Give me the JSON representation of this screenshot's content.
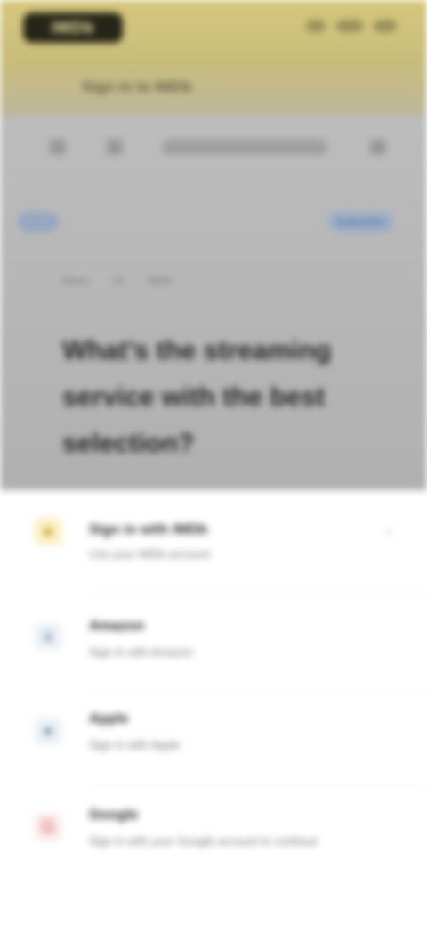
{
  "header": {
    "logo_text": "IMDb",
    "breadcrumb": "Sign in to IMDb"
  },
  "article": {
    "subscribe_label": "Subscribe",
    "meta": [
      "News",
      "2h",
      "IMDb"
    ],
    "headline": "What’s the streaming service with the best selection?"
  },
  "sheet": {
    "items": [
      {
        "title": "Sign in with IMDb",
        "subtitle": "Use your IMDb account",
        "icon": "imdb-icon"
      },
      {
        "title": "Amazon",
        "subtitle": "Sign in with Amazon",
        "icon": "amazon-icon"
      },
      {
        "title": "Apple",
        "subtitle": "Sign in with Apple",
        "icon": "apple-icon"
      },
      {
        "title": "Google",
        "subtitle": "Sign in with your Google account to continue",
        "icon": "google-icon"
      }
    ]
  },
  "colors": {
    "brand_bar": "#d6c77a",
    "logo_bg": "#262618",
    "sheet_bg": "#ffffff",
    "link_blue": "#2b4f88"
  }
}
